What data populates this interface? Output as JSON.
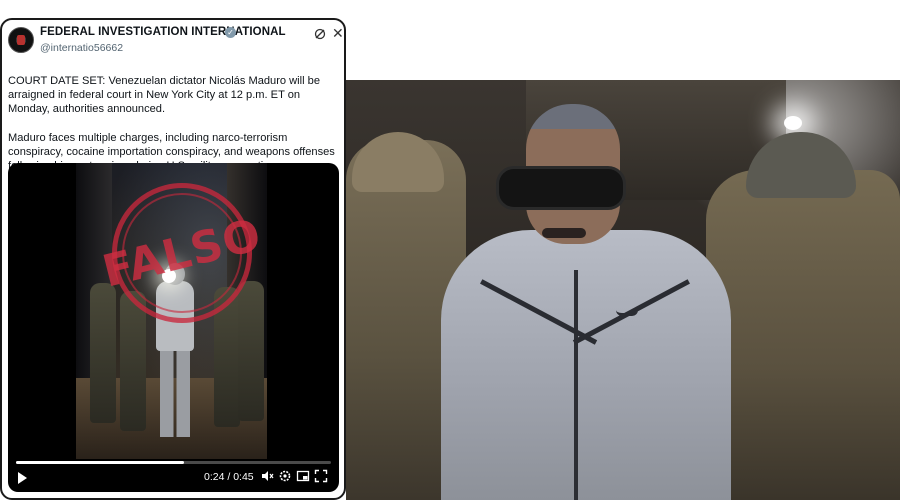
{
  "tweet": {
    "account_name": "FEDERAL INVESTIGATION INTERNATIONAL",
    "handle": "@internatio56662",
    "paragraphs": [
      "COURT DATE SET: Venezuelan dictator Nicolás Maduro will be arraigned in federal court in New York City at 12 p.m. ET on Monday, authorities announced.",
      "Maduro faces multiple charges, including narco-terrorism conspiracy, cocaine importation conspiracy, and weapons offenses following his capture in a daring U.S. military operation."
    ]
  },
  "video": {
    "stamp_text": "FALSO",
    "time_current": "0:24",
    "time_total": "0:45",
    "time_display": "0:24 / 0:45",
    "progress": 0.533
  },
  "colors": {
    "stamp_red": "#cd2d41",
    "verified_gray": "#829aab",
    "text_primary": "#0f1419",
    "text_secondary": "#536471"
  },
  "icons": {
    "verified": "verified-badge-icon",
    "grok": "grok-icon",
    "close": "close-icon",
    "play": "play-icon",
    "volume": "volume-icon",
    "settings": "settings-gear-icon",
    "pip": "picture-in-picture-icon",
    "fullscreen": "fullscreen-icon"
  }
}
